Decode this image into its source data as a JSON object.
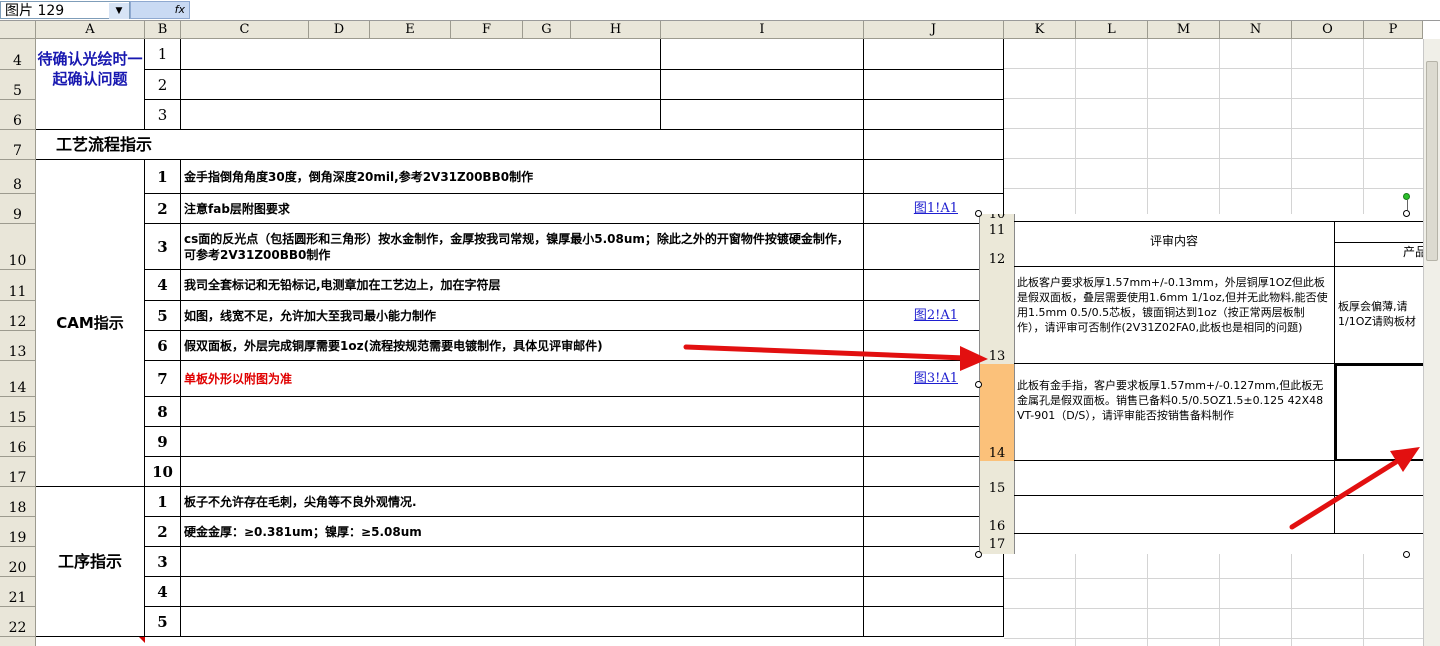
{
  "formula_bar": {
    "name_box": "图片 129",
    "fx": "fx"
  },
  "columns": [
    "A",
    "B",
    "C",
    "D",
    "E",
    "F",
    "G",
    "H",
    "I",
    "J",
    "K",
    "L",
    "M",
    "N",
    "O",
    "P"
  ],
  "rows": [
    "4",
    "5",
    "6",
    "7",
    "8",
    "9",
    "10",
    "11",
    "12",
    "13",
    "14",
    "15",
    "16",
    "17",
    "18",
    "19",
    "20",
    "21",
    "22"
  ],
  "sheet": {
    "confirm_label": "待确认光绘时一起确认问题",
    "confirm_nums": [
      "1",
      "2",
      "3"
    ],
    "process_flow": "工艺流程指示",
    "cam_label": "CAM指示",
    "cam_nums": [
      "1",
      "2",
      "3",
      "4",
      "5",
      "6",
      "7",
      "8",
      "9",
      "10"
    ],
    "cam_items": [
      "金手指倒角角度30度，倒角深度20mil,参考2V31Z00BB0制作",
      "注意fab层附图要求",
      "cs面的反光点（包括圆形和三角形）按水金制作，金厚按我司常规，镍厚最小5.08um；除此之外的开窗物件按镀硬金制作，可参考2V31Z00BB0制作",
      "我司全套标记和无铅标记,电测章加在工艺边上，加在字符层",
      "如图，线宽不足，允许加大至我司最小能力制作",
      "假双面板，外层完成铜厚需要1oz(流程按规范需要电镀制作，具体见评审邮件)",
      "单板外形以附图为准"
    ],
    "links": [
      "图1!A1",
      "图2!A1",
      "图3!A1"
    ],
    "process_label": "工序指示",
    "process_nums": [
      "1",
      "2",
      "3",
      "4",
      "5"
    ],
    "process_items": [
      "板子不允许存在毛刺，尖角等不良外观情况.",
      "硬金金厚：≥0.381um；镍厚：≥5.08um"
    ]
  },
  "picture": {
    "row_labels": [
      "10",
      "11",
      "12",
      "13",
      "14",
      "15",
      "16",
      "17"
    ],
    "header_review": "评审内容",
    "header_product": "产品",
    "review_13": "此板客户要求板厚1.57mm+/-0.13mm，外层铜厚1OZ但此板是假双面板，叠层需要使用1.6mm 1/1oz,但并无此物料,能否使用1.5mm 0.5/0.5芯板，镀面铜达到1oz（按正常两层板制作），请评审可否制作(2V31Z02FA0,此板也是相同的问题)",
    "product_13": "板厚会偏薄,请1/1OZ请购板材",
    "review_14": "此板有金手指，客户要求板厚1.57mm+/-0.127mm,但此板无金属孔是假双面板。销售已备料0.5/0.5OZ1.5±0.125 42X48  VT-901（D/S），请评审能否按销售备料制作"
  },
  "colors": {
    "blue_text": "#1818b0",
    "red_text": "#e00000",
    "arrow": "#e21010",
    "highlight_row": "#fbc17a"
  }
}
